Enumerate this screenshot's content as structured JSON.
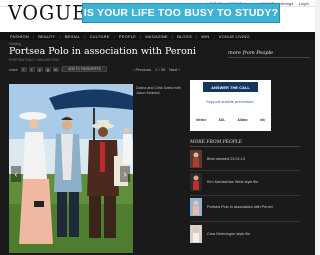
{
  "top_links": [
    "VOGUE",
    "VOGUE forum",
    "VOGUE weddings",
    "Login"
  ],
  "logo": "VOGUE",
  "banner_ad": {
    "text": "IS YOUR LIFE TOO BUSY TO STUDY?",
    "color": "#3fb3d3"
  },
  "nav": [
    "FASHION",
    "BEAUTY",
    "BRIDAL",
    "CULTURE",
    "PEOPLE",
    "MAGAZINE",
    "BLOGS",
    "WIN",
    "VOGUE LIVING"
  ],
  "breadcrumb": "Viewing",
  "article": {
    "title": "Portsea Polo in association with Peroni",
    "subtitle": "PORTSEA POLO / JANUARY 2013",
    "share_label": "share",
    "share_icons": [
      "f",
      "t",
      "p",
      "g",
      "m",
      "e"
    ],
    "add_button": "ADD TO FAVOURITES",
    "prev": "‹ Previous",
    "counter": "1 / 39",
    "next": "Next ›",
    "caption": "Dasha and Celia Sweid with Jason Mesnick"
  },
  "sidebar": {
    "more_from": "more from People",
    "ad": {
      "button": "ANSWER THE CALL",
      "text": "Support suicide prevention.",
      "sponsors": [
        "lifeline",
        "AOL",
        "Allianz",
        "nib"
      ]
    },
    "more_from_people": "MORE FROM PEOPLE",
    "items": [
      {
        "label": "Best dressed 24.01.13"
      },
      {
        "label": "Kim Kardashian West style file"
      },
      {
        "label": "Portsea Polo in association with Peroni"
      },
      {
        "label": "Cara Delevingne style file"
      }
    ]
  }
}
